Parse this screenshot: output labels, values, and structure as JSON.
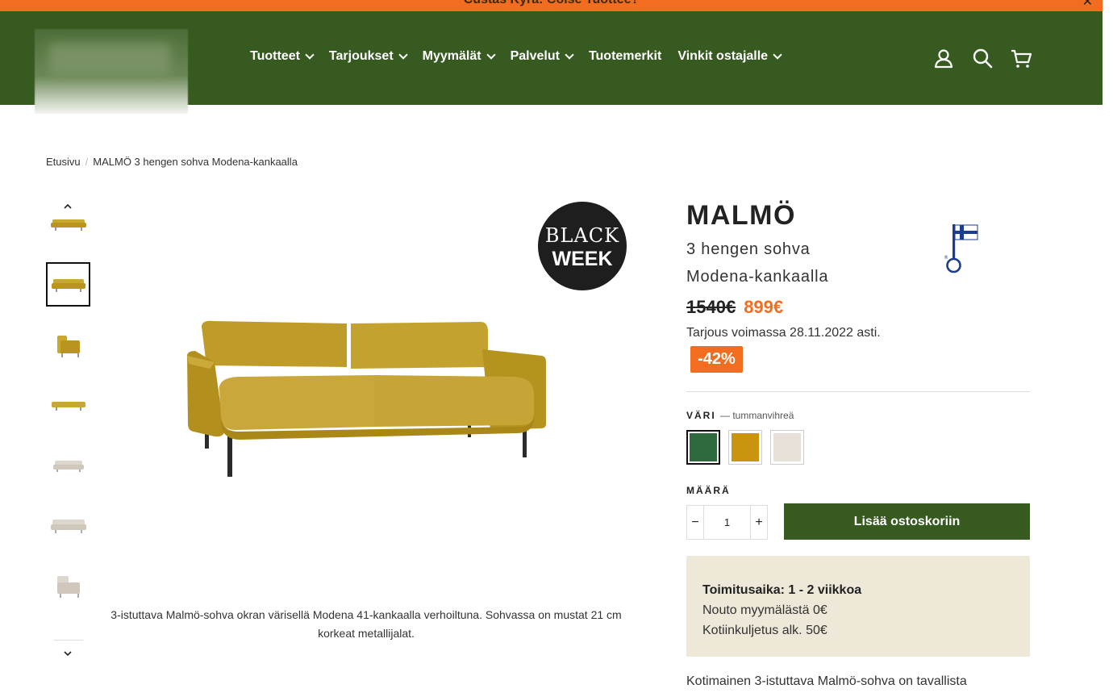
{
  "announcement": {
    "text": "Custas Kyra: Colse Tuottee?",
    "close_icon": "close-icon"
  },
  "header": {
    "logo_alt": "",
    "nav": [
      "Tuotteet",
      "Tarjoukset",
      "Myymälät",
      "Palvelut",
      "Tuotemerkit",
      "Vinkit ostajalle"
    ],
    "nav_dropdown": [
      true,
      true,
      true,
      true,
      false,
      true
    ],
    "icons": [
      "account-icon",
      "search-icon",
      "cart-icon"
    ]
  },
  "breadcrumb": {
    "home": "Etusivu",
    "separator": "/",
    "current": "MALMÖ 3 hengen sohva Modena-kankaalla"
  },
  "gallery": {
    "badge_line1": "BLACK",
    "badge_line2": "WEEK",
    "caption": "3-istuttava Malmö-sohva okran värisellä Modena 41-kankaalla verhoiltuna. Sohvassa on mustat 21 cm korkeat metallijalat.",
    "thumbnail_count": 7,
    "selected_thumbnail": 1
  },
  "product": {
    "title": "MALMÖ",
    "subtitle": "3 hengen sohva Modena-kankaalla",
    "old_price": "1540€",
    "new_price": "899€",
    "offer_text": "Tarjous voimassa 28.11.2022 asti.",
    "discount": "-42%",
    "color_label": "VÄRI",
    "color_selected": "— tummanvihreä",
    "swatches": [
      "#2e6a3e",
      "#c9940f",
      "#e6e0d9"
    ],
    "quantity_label": "MÄÄRÄ",
    "quantity": "1",
    "add_to_cart": "Lisää ostoskoriin",
    "delivery_label": "Toimitusaika:",
    "delivery_time": "1 - 2 viikkoa",
    "pickup": "Nouto myymälästä 0€",
    "home_delivery": "Kotiinkuljetus alk. 50€",
    "description": "Kotimainen 3-istuttava Malmö-sohva on tavallista"
  },
  "colors": {
    "brand_green": "#365a20",
    "accent_orange": "#f26d1f",
    "delivery_bg": "#ede8d8"
  }
}
